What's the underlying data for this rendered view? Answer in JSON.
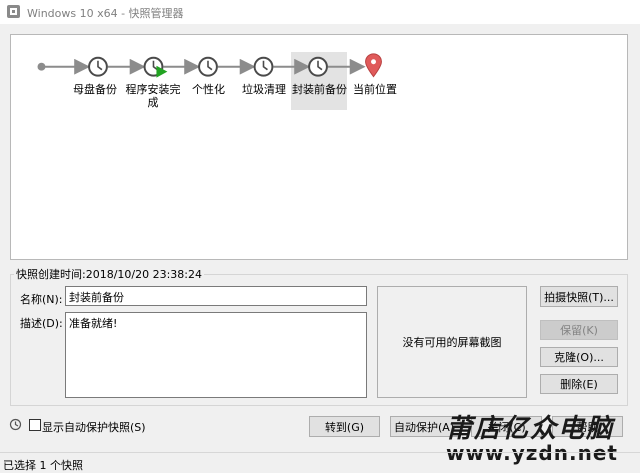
{
  "window": {
    "title": "Windows 10 x64 - 快照管理器",
    "app_icon": "vmware-icon"
  },
  "tree": {
    "start_icon": "circle-dot-icon",
    "nodes": [
      {
        "label": "母盘备份",
        "icon": "clock-icon"
      },
      {
        "label": "程序安装完成",
        "icon": "clock-play-icon"
      },
      {
        "label": "个性化",
        "icon": "clock-icon"
      },
      {
        "label": "垃圾清理",
        "icon": "clock-icon"
      },
      {
        "label": "封装前备份",
        "icon": "clock-icon",
        "selected": true
      },
      {
        "label": "当前位置",
        "icon": "location-pin-icon"
      }
    ],
    "colors": {
      "line": "#8c8c8c",
      "clock": "#4a4a4a",
      "play": "#22a322",
      "pin": "#e05a5a"
    }
  },
  "details": {
    "created_caption": "快照创建时间:2018/10/20 23:38:24",
    "name_label": "名称(N):",
    "name_value": "封装前备份",
    "desc_label": "描述(D):",
    "desc_value": "准备就绪!",
    "preview_text": "没有可用的屏幕截图"
  },
  "buttons": {
    "take_snapshot": "拍摄快照(T)...",
    "keep": "保留(K)",
    "clone": "克隆(O)...",
    "delete": "删除(E)",
    "goto": "转到(G)",
    "autoprotect": "自动保护(A)...",
    "close": "关闭(C)",
    "help": "帮助"
  },
  "bottom": {
    "show_autoprotect_label": "显示自动保护快照(S)",
    "show_autoprotect_checked": false,
    "history_icon": "history-clock-icon"
  },
  "status": {
    "text": "已选择 1 个快照"
  },
  "watermark": {
    "brand": "莆店亿众电脑",
    "url": "www.yzdn.net"
  }
}
